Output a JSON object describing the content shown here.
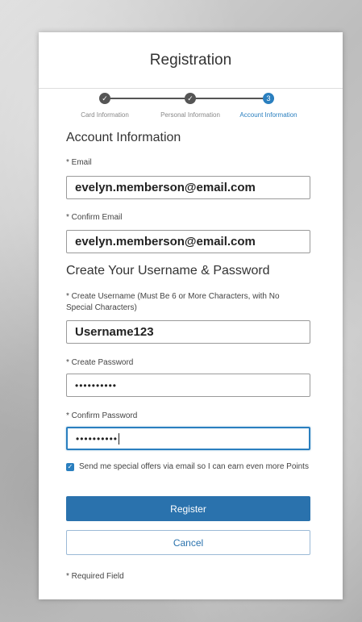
{
  "header": {
    "title": "Registration"
  },
  "stepper": {
    "steps": [
      {
        "label": "Card Information",
        "status": "done",
        "marker": "✓"
      },
      {
        "label": "Personal Information",
        "status": "done",
        "marker": "✓"
      },
      {
        "label": "Account Information",
        "status": "active",
        "marker": "3"
      }
    ]
  },
  "account_section": {
    "title": "Account Information",
    "email_label": "* Email",
    "email_value": "evelyn.memberson@email.com",
    "confirm_email_label": "* Confirm Email",
    "confirm_email_value": "evelyn.memberson@email.com"
  },
  "credentials_section": {
    "title": "Create Your Username & Password",
    "username_label": "* Create Username (Must Be 6 or More Characters, with No Special Characters)",
    "username_value": "Username123",
    "password_label": "* Create Password",
    "password_value": "••••••••••",
    "confirm_password_label": "* Confirm Password",
    "confirm_password_value": "••••••••••"
  },
  "offers_checkbox": {
    "checked": true,
    "label": "Send me special offers via email so I can earn even more Points"
  },
  "buttons": {
    "register": "Register",
    "cancel": "Cancel"
  },
  "footer": {
    "required_note": "* Required Field"
  },
  "colors": {
    "accent": "#2a72ad",
    "step_done": "#555555",
    "step_active": "#2a7fbf"
  }
}
